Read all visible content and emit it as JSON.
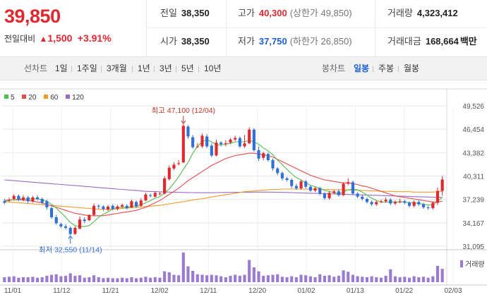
{
  "quote": {
    "price": "39,850",
    "change_label": "전일대비",
    "change_arrow": "▲",
    "change_amount": "1,500",
    "change_pct": "+3.91%"
  },
  "stats": {
    "prev_close_label": "전일",
    "prev_close": "38,350",
    "high_label": "고가",
    "high": "40,300",
    "upper_limit": "(상한가 49,850)",
    "volume_label": "거래량",
    "volume": "4,323,412",
    "open_label": "시가",
    "open": "38,350",
    "low_label": "저가",
    "low": "37,750",
    "lower_limit": "(하한가 26,850)",
    "amount_label": "거래대금",
    "amount": "168,664",
    "amount_unit": "백만"
  },
  "toolbar": {
    "line_label": "선차트",
    "ranges": [
      "1일",
      "1주일",
      "3개월",
      "1년",
      "3년",
      "5년",
      "10년"
    ],
    "candle_label": "봉차트",
    "candle_periods": [
      "일봉",
      "주봉",
      "월봉"
    ],
    "active_candle": "일봉"
  },
  "legend": {
    "items": [
      {
        "label": "5",
        "color": "#4fbf4f"
      },
      {
        "label": "20",
        "color": "#e64b4b"
      },
      {
        "label": "60",
        "color": "#f39a2b"
      },
      {
        "label": "120",
        "color": "#9a6bc8"
      }
    ],
    "volume_label": "거래량"
  },
  "colors": {
    "up": "#e0282e",
    "down": "#2f6fd6",
    "volume": "#9a7bd0",
    "grid": "#e8e8e8"
  },
  "chart_data": {
    "type": "candlestick",
    "y_ticks": [
      "49,526",
      "46,454",
      "43,382",
      "40,311",
      "37,239",
      "34,167",
      "31,095"
    ],
    "ylim": [
      31095,
      49526
    ],
    "x_labels": [
      "11/01",
      "11/12",
      "11/21",
      "12/02",
      "12/11",
      "12/20",
      "01/02",
      "01/13",
      "01/22",
      "02/03"
    ],
    "annotations": {
      "high": "최고 47,100 (12/04)",
      "low": "최저 32,550 (11/14)"
    },
    "candles": [
      [
        37000,
        36800,
        37300,
        36600
      ],
      [
        37100,
        37200,
        37500,
        36900
      ],
      [
        37300,
        37700,
        37900,
        37100
      ],
      [
        37700,
        37200,
        37900,
        37000
      ],
      [
        37200,
        37500,
        37800,
        37000
      ],
      [
        37500,
        37000,
        37700,
        36700
      ],
      [
        37000,
        37500,
        37700,
        36800
      ],
      [
        37500,
        37300,
        37800,
        37100
      ],
      [
        37300,
        36800,
        37500,
        36600
      ],
      [
        37000,
        36200,
        37200,
        35900
      ],
      [
        36100,
        34900,
        36300,
        34700
      ],
      [
        34900,
        34100,
        35200,
        33900
      ],
      [
        34000,
        33700,
        34200,
        33500
      ],
      [
        33700,
        33500,
        34000,
        33300
      ],
      [
        33500,
        32700,
        33700,
        32550
      ],
      [
        32700,
        33500,
        33700,
        32600
      ],
      [
        33400,
        34600,
        35000,
        33300
      ],
      [
        34600,
        34400,
        34900,
        34100
      ],
      [
        34500,
        35200,
        35300,
        34400
      ],
      [
        35200,
        36400,
        36700,
        35000
      ],
      [
        36400,
        36300,
        36600,
        36000
      ],
      [
        36300,
        36000,
        36500,
        35700
      ],
      [
        35900,
        36300,
        36500,
        35700
      ],
      [
        36400,
        36000,
        36600,
        35800
      ],
      [
        36000,
        36300,
        36500,
        35800
      ],
      [
        36300,
        36500,
        36700,
        36100
      ],
      [
        36400,
        36100,
        36600,
        35900
      ],
      [
        36200,
        37000,
        37200,
        36100
      ],
      [
        36900,
        36300,
        37100,
        36100
      ],
      [
        36400,
        37100,
        37400,
        36300
      ],
      [
        37100,
        37900,
        38100,
        37000
      ],
      [
        37800,
        37700,
        38000,
        37500
      ],
      [
        37600,
        38100,
        38300,
        37500
      ],
      [
        38000,
        38000,
        38200,
        37800
      ],
      [
        38000,
        40000,
        40300,
        37900
      ],
      [
        39900,
        41400,
        41700,
        39700
      ],
      [
        41300,
        41800,
        42100,
        41100
      ],
      [
        41900,
        42000,
        42400,
        41700
      ],
      [
        42100,
        46900,
        47100,
        42000
      ],
      [
        46800,
        45500,
        47000,
        45200
      ],
      [
        45400,
        44100,
        45700,
        43900
      ],
      [
        44200,
        44200,
        44600,
        44000
      ],
      [
        44200,
        45600,
        45900,
        44000
      ],
      [
        45500,
        44200,
        45800,
        44000
      ],
      [
        44300,
        43000,
        44600,
        42800
      ],
      [
        43000,
        44700,
        45100,
        42900
      ],
      [
        44700,
        44500,
        44900,
        44200
      ],
      [
        44500,
        44600,
        45000,
        44200
      ],
      [
        44700,
        45100,
        45300,
        44500
      ],
      [
        45100,
        45300,
        45600,
        44900
      ],
      [
        45300,
        44200,
        45500,
        44000
      ],
      [
        44200,
        44600,
        45700,
        44000
      ],
      [
        44600,
        46400,
        46700,
        44500
      ],
      [
        46400,
        43700,
        46600,
        43500
      ],
      [
        43700,
        42600,
        44200,
        42300
      ],
      [
        42700,
        43300,
        43500,
        42400
      ],
      [
        43200,
        42400,
        43400,
        42200
      ],
      [
        42400,
        41300,
        42600,
        41000
      ],
      [
        41300,
        40700,
        41500,
        40400
      ],
      [
        40700,
        40000,
        40900,
        39700
      ],
      [
        40000,
        39800,
        40200,
        39600
      ],
      [
        39800,
        39000,
        40000,
        38700
      ],
      [
        39000,
        38700,
        39300,
        38500
      ],
      [
        38700,
        39600,
        39800,
        38500
      ],
      [
        39600,
        38900,
        39800,
        38700
      ],
      [
        38900,
        38400,
        39100,
        38200
      ],
      [
        38400,
        38700,
        38900,
        38200
      ],
      [
        38700,
        38000,
        38900,
        37800
      ],
      [
        38000,
        37400,
        38200,
        37200
      ],
      [
        37400,
        38100,
        38300,
        37200
      ],
      [
        38100,
        38300,
        38500,
        37900
      ],
      [
        38300,
        37800,
        38600,
        37600
      ],
      [
        37800,
        39300,
        39500,
        37700
      ],
      [
        39300,
        39500,
        40000,
        39100
      ],
      [
        39500,
        38000,
        39700,
        37800
      ],
      [
        38000,
        37600,
        38200,
        37400
      ],
      [
        37600,
        37300,
        37800,
        37100
      ],
      [
        37300,
        36900,
        37500,
        36700
      ],
      [
        36900,
        36600,
        37100,
        36400
      ],
      [
        36600,
        36900,
        37100,
        36400
      ],
      [
        36900,
        37000,
        37200,
        36700
      ],
      [
        37000,
        37200,
        37500,
        36800
      ],
      [
        37200,
        36700,
        37400,
        36500
      ],
      [
        36700,
        36900,
        37100,
        36500
      ],
      [
        36900,
        37000,
        37300,
        36700
      ],
      [
        37000,
        36800,
        37200,
        36600
      ],
      [
        36800,
        36400,
        37000,
        36200
      ],
      [
        36400,
        36900,
        37100,
        36200
      ],
      [
        36900,
        36600,
        37100,
        36400
      ],
      [
        36600,
        36200,
        36800,
        36000
      ],
      [
        36200,
        36100,
        36400,
        35900
      ],
      [
        36100,
        36800,
        37000,
        35900
      ],
      [
        36800,
        38350,
        38800,
        36500
      ],
      [
        38350,
        39850,
        40300,
        37750
      ]
    ],
    "ma5": [
      37000,
      37100,
      37200,
      37300,
      37300,
      37300,
      37300,
      37300,
      37200,
      37000,
      36600,
      36100,
      35500,
      34900,
      34200,
      33800,
      33700,
      33700,
      33800,
      34300,
      34900,
      35300,
      35600,
      36000,
      36200,
      36200,
      36200,
      36300,
      36400,
      36500,
      36800,
      37100,
      37400,
      37600,
      38100,
      38600,
      39400,
      40200,
      41200,
      42100,
      43300,
      44200,
      44800,
      45100,
      44800,
      44400,
      44400,
      44500,
      44600,
      44800,
      44800,
      44800,
      45000,
      44800,
      44500,
      44000,
      43600,
      43100,
      42400,
      41800,
      41200,
      40600,
      40100,
      39800,
      39400,
      39100,
      38900,
      38700,
      38400,
      38300,
      38100,
      38000,
      38200,
      38500,
      38600,
      38500,
      38200,
      37800,
      37400,
      37100,
      36900,
      36900,
      36900,
      36900,
      36900,
      36900,
      36800,
      36800,
      36700,
      36600,
      36500,
      36500,
      37000,
      37500
    ],
    "ma20": [
      37100,
      37150,
      37200,
      37200,
      37150,
      37100,
      37000,
      36900,
      36800,
      36600,
      36400,
      36200,
      36000,
      35800,
      35600,
      35400,
      35300,
      35200,
      35100,
      35100,
      35100,
      35100,
      35200,
      35300,
      35400,
      35500,
      35600,
      35700,
      35800,
      36000,
      36200,
      36500,
      36800,
      37100,
      37500,
      37900,
      38300,
      38700,
      39200,
      39700,
      40100,
      40500,
      40900,
      41300,
      41700,
      42000,
      42300,
      42600,
      42800,
      43000,
      43100,
      43200,
      43300,
      43300,
      43200,
      43100,
      43000,
      42800,
      42500,
      42200,
      41900,
      41600,
      41300,
      41000,
      40700,
      40400,
      40200,
      40000,
      39800,
      39700,
      39600,
      39500,
      39400,
      39400,
      39300,
      39200,
      39000,
      38900,
      38700,
      38500,
      38300,
      38100,
      37900,
      37700,
      37600,
      37500,
      37400,
      37300,
      37200,
      37100,
      37000,
      36900,
      36900,
      37000
    ],
    "ma60": [
      36900,
      36900,
      36850,
      36800,
      36750,
      36700,
      36650,
      36600,
      36550,
      36500,
      36450,
      36400,
      36350,
      36300,
      36250,
      36200,
      36150,
      36100,
      36050,
      36000,
      35950,
      35950,
      35950,
      35950,
      36000,
      36050,
      36100,
      36150,
      36200,
      36250,
      36300,
      36350,
      36400,
      36450,
      36550,
      36650,
      36750,
      36850,
      36950,
      37050,
      37150,
      37250,
      37350,
      37450,
      37550,
      37650,
      37750,
      37850,
      37950,
      38050,
      38150,
      38250,
      38300,
      38350,
      38400,
      38450,
      38500,
      38550,
      38550,
      38600,
      38600,
      38600,
      38600,
      38600,
      38600,
      38600,
      38600,
      38600,
      38550,
      38550,
      38500,
      38500,
      38500,
      38500,
      38450,
      38450,
      38400,
      38400,
      38350,
      38350,
      38300,
      38300,
      38300,
      38250,
      38250,
      38250,
      38250,
      38200,
      38200,
      38200,
      38200,
      38200,
      38250,
      38300
    ],
    "ma120": [
      39800,
      39750,
      39700,
      39650,
      39600,
      39550,
      39500,
      39450,
      39400,
      39350,
      39300,
      39250,
      39200,
      39150,
      39100,
      39050,
      39000,
      38950,
      38900,
      38850,
      38800,
      38750,
      38700,
      38650,
      38600,
      38550,
      38500,
      38450,
      38400,
      38350,
      38300,
      38280,
      38260,
      38240,
      38220,
      38200,
      38180,
      38160,
      38150,
      38140,
      38130,
      38120,
      38120,
      38120,
      38120,
      38130,
      38140,
      38150,
      38160,
      38170,
      38180,
      38180,
      38190,
      38200,
      38200,
      38200,
      38200,
      38190,
      38180,
      38170,
      38150,
      38130,
      38110,
      38090,
      38070,
      38050,
      38030,
      38010,
      37990,
      37970,
      37950,
      37930,
      37910,
      37890,
      37870,
      37850,
      37830,
      37810,
      37790,
      37770,
      37750,
      37730,
      37710,
      37690,
      37670,
      37650,
      37630,
      37610,
      37590,
      37570,
      37550,
      37530,
      37510,
      37500
    ],
    "volume": [
      1.0,
      1.1,
      1.2,
      0.9,
      1.0,
      1.0,
      1.1,
      0.9,
      1.0,
      1.3,
      1.5,
      1.6,
      1.2,
      1.3,
      1.8,
      1.3,
      1.4,
      0.9,
      1.0,
      1.4,
      1.0,
      0.8,
      0.9,
      0.8,
      0.8,
      0.9,
      0.8,
      1.0,
      0.8,
      0.9,
      1.1,
      0.9,
      1.0,
      0.9,
      2.2,
      2.0,
      1.5,
      1.4,
      6.0,
      3.2,
      2.3,
      1.6,
      1.5,
      1.4,
      1.5,
      1.4,
      1.2,
      1.0,
      1.3,
      1.5,
      1.3,
      1.5,
      4.5,
      3.0,
      2.2,
      1.3,
      1.4,
      1.5,
      1.6,
      1.1,
      1.0,
      1.2,
      1.0,
      1.5,
      1.4,
      1.2,
      1.0,
      1.6,
      1.3,
      1.4,
      1.1,
      1.3,
      2.4,
      2.1,
      1.5,
      1.2,
      1.1,
      1.0,
      1.2,
      1.0,
      0.9,
      1.3,
      2.6,
      1.2,
      1.0,
      1.1,
      0.9,
      1.2,
      1.0,
      1.1,
      0.9,
      1.2,
      3.3,
      2.7
    ]
  }
}
